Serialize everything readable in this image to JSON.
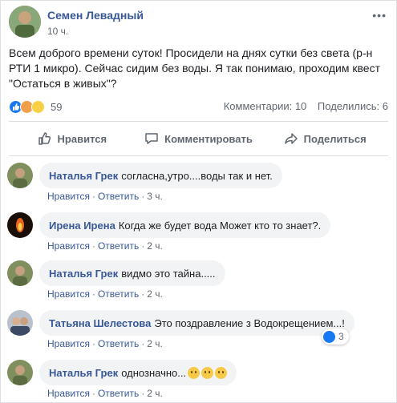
{
  "post": {
    "author": "Семен Левадный",
    "time": "10 ч.",
    "text": "Всем доброго времени суток! Просидели на днях сутки без света (р-н РТИ 1 микро). Сейчас сидим без воды. Я так понимаю, проходим квест \"Остаться в живых\"?",
    "reactions_count": "59",
    "comments_label": "Комментарии: 10",
    "shares_label": "Поделились: 6"
  },
  "actions": {
    "like": "Нравится",
    "comment": "Комментировать",
    "share": "Поделиться"
  },
  "comment_ui": {
    "like": "Нравится",
    "reply": "Ответить",
    "dot": "·"
  },
  "comments": [
    {
      "name": "Наталья Грек",
      "text": "согласна,утро....воды так и нет.",
      "time": "3 ч."
    },
    {
      "name": "Ирена Ирена",
      "text": "Когда же будет вода Может кто то знает?.",
      "time": "2 ч."
    },
    {
      "name": "Наталья Грек",
      "text": "видмо это тайна.....",
      "time": "2 ч."
    },
    {
      "name": "Татьяна Шелестова",
      "text": "Это поздравление з Водокрещением...!",
      "time": "2 ч.",
      "likes": "3"
    },
    {
      "name": "Наталья Грек",
      "text": "однозначно...",
      "time": "2 ч."
    }
  ],
  "colors": {
    "link": "#385898",
    "like_blue": "#1877f2",
    "muted": "#606770",
    "bubble": "#f2f3f5"
  }
}
